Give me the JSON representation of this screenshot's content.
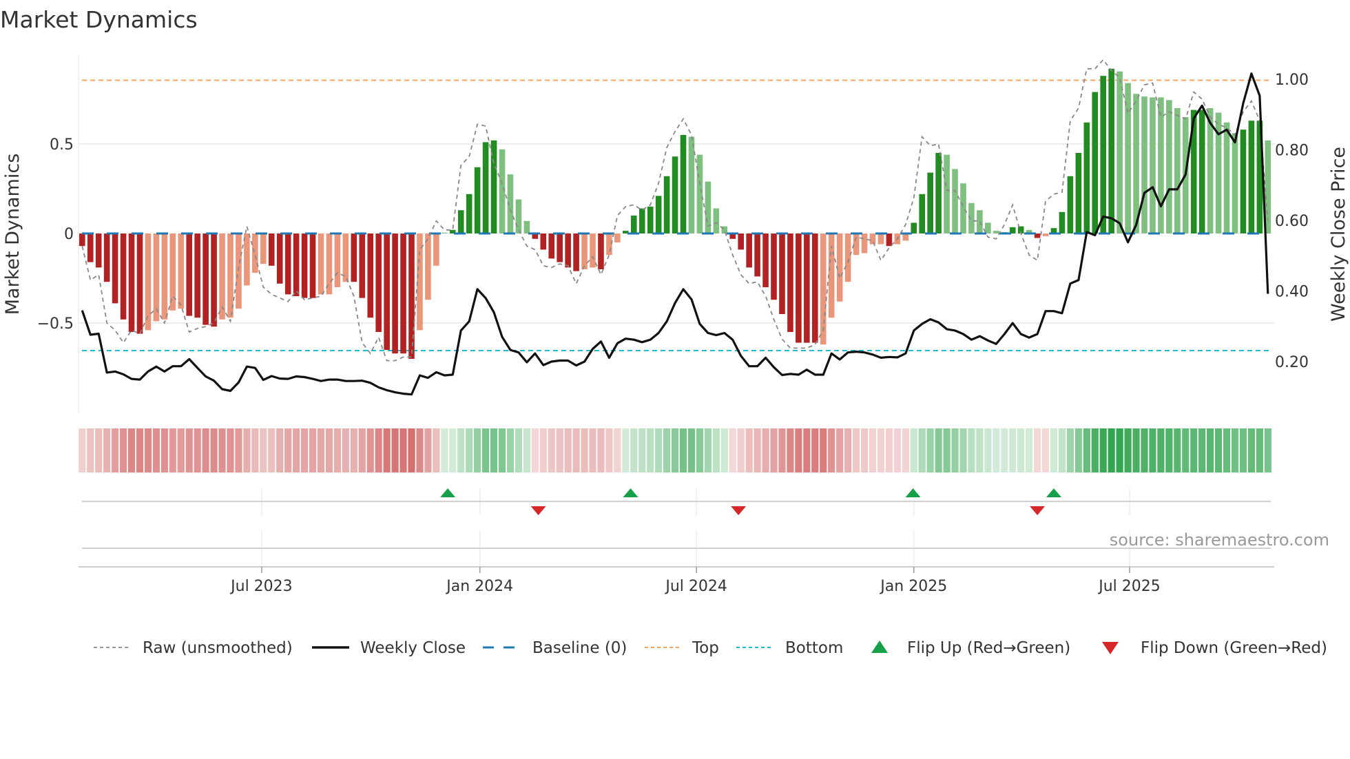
{
  "title": "Market Dynamics",
  "source": "source: sharemaestro.com",
  "colors": {
    "bar_neg_strong": "#b22222",
    "bar_neg_weak": "#e9967a",
    "bar_pos_strong": "#228b22",
    "bar_pos_weak": "#7fbf7f",
    "raw": "#888888",
    "close": "#111111",
    "baseline": "#1f77b4",
    "top": "#f4a460",
    "bottom": "#17becf",
    "flip_up": "#16a04a",
    "flip_down": "#d62728",
    "strip_red": "200,70,70",
    "strip_green": "40,160,70"
  },
  "chart_data": {
    "type": "bar",
    "title": "Market Dynamics",
    "ylabel": "Market Dynamics",
    "y2label": "Weekly Close Price",
    "ylim": [
      -1.0,
      0.99
    ],
    "y2lim": [
      0.0,
      1.225
    ],
    "yticks": [
      {
        "value": 0.5,
        "label": "0.5"
      },
      {
        "value": 0,
        "label": "0"
      },
      {
        "value": -0.5,
        "label": "−0.5"
      }
    ],
    "y2ticks": [
      {
        "value": 1.0,
        "label": "1.00"
      },
      {
        "value": 0.8,
        "label": "0.80"
      },
      {
        "value": 0.6,
        "label": "0.60"
      },
      {
        "value": 0.4,
        "label": "0.40"
      },
      {
        "value": 0.2,
        "label": "0.20"
      }
    ],
    "grid_y": [
      0.5,
      -0.5
    ],
    "x_unit": "week index (1 = first bar)",
    "xlim": [
      0.6,
      145.5
    ],
    "xticks": [
      {
        "week": 22.8,
        "label": "Jul 2023"
      },
      {
        "week": 49.3,
        "label": "Jan 2024"
      },
      {
        "week": 75.6,
        "label": "Jul 2024"
      },
      {
        "week": 102.0,
        "label": "Jan 2025"
      },
      {
        "week": 128.2,
        "label": "Jul 2025"
      }
    ],
    "top_level": 0.856,
    "bottom_level": -0.654,
    "baseline": 0,
    "values": [
      -0.07,
      -0.16,
      -0.19,
      -0.27,
      -0.39,
      -0.48,
      -0.55,
      -0.56,
      -0.54,
      -0.49,
      -0.48,
      -0.43,
      -0.42,
      -0.46,
      -0.47,
      -0.51,
      -0.52,
      -0.48,
      -0.47,
      -0.42,
      -0.29,
      -0.22,
      -0.17,
      -0.18,
      -0.28,
      -0.34,
      -0.35,
      -0.36,
      -0.36,
      -0.34,
      -0.34,
      -0.3,
      -0.27,
      -0.27,
      -0.36,
      -0.47,
      -0.55,
      -0.65,
      -0.67,
      -0.67,
      -0.7,
      -0.54,
      -0.37,
      -0.18,
      0.005,
      0.02,
      0.13,
      0.22,
      0.37,
      0.51,
      0.52,
      0.47,
      0.33,
      0.19,
      0.07,
      -0.03,
      -0.09,
      -0.14,
      -0.16,
      -0.19,
      -0.21,
      -0.2,
      -0.19,
      -0.2,
      -0.12,
      -0.05,
      0.015,
      0.1,
      0.14,
      0.15,
      0.21,
      0.32,
      0.43,
      0.55,
      0.54,
      0.44,
      0.29,
      0.14,
      0.04,
      -0.03,
      -0.09,
      -0.19,
      -0.24,
      -0.3,
      -0.37,
      -0.45,
      -0.55,
      -0.61,
      -0.61,
      -0.61,
      -0.62,
      -0.47,
      -0.38,
      -0.27,
      -0.12,
      -0.11,
      -0.06,
      -0.06,
      -0.07,
      -0.06,
      -0.04,
      0.06,
      0.22,
      0.34,
      0.45,
      0.44,
      0.36,
      0.28,
      0.17,
      0.13,
      0.06,
      0.015,
      0.008,
      0.035,
      0.04,
      0.02,
      -0.025,
      -0.015,
      0.03,
      0.12,
      0.32,
      0.45,
      0.62,
      0.79,
      0.88,
      0.92,
      0.905,
      0.84,
      0.78,
      0.765,
      0.76,
      0.76,
      0.745,
      0.7,
      0.65,
      0.69,
      0.69,
      0.7,
      0.675,
      0.62,
      0.56,
      0.58,
      0.63,
      0.63,
      0.52
    ],
    "momentum_shade": "DDDDDDDD LLLLL DDDD LLLLLL DDDDDD LLLL DDDDDDDD LLLL DDDDDD LLLL DDDDDD LL D LL DDDDDDDD LLLLL DDDDDDDDDDD LLLLLLLL D LL DDDD LLLLLLLL DD L D L DDDDDDDD LLLLLLLLL DD LLLL DDD L",
    "raw": [
      -0.07,
      -0.26,
      -0.23,
      -0.5,
      -0.54,
      -0.61,
      -0.54,
      -0.56,
      -0.46,
      -0.42,
      -0.5,
      -0.35,
      -0.4,
      -0.55,
      -0.53,
      -0.52,
      -0.5,
      -0.41,
      -0.49,
      -0.19,
      0.04,
      -0.12,
      -0.3,
      -0.34,
      -0.36,
      -0.38,
      -0.32,
      -0.37,
      -0.36,
      -0.35,
      -0.28,
      -0.22,
      -0.24,
      -0.35,
      -0.61,
      -0.67,
      -0.58,
      -0.71,
      -0.71,
      -0.69,
      -0.69,
      -0.09,
      -0.03,
      0.07,
      0.02,
      0.02,
      0.38,
      0.43,
      0.61,
      0.6,
      0.39,
      0.28,
      0.13,
      0.02,
      -0.07,
      -0.09,
      -0.18,
      -0.19,
      -0.17,
      -0.18,
      -0.28,
      -0.18,
      -0.13,
      -0.23,
      -0.12,
      0.1,
      0.15,
      0.16,
      0.13,
      0.16,
      0.28,
      0.48,
      0.57,
      0.64,
      0.55,
      0.28,
      0.04,
      0.06,
      0.02,
      -0.12,
      -0.23,
      -0.28,
      -0.27,
      -0.35,
      -0.48,
      -0.59,
      -0.64,
      -0.64,
      -0.64,
      -0.62,
      -0.54,
      -0.07,
      -0.25,
      -0.16,
      -0.02,
      -0.03,
      -0.04,
      -0.15,
      -0.08,
      -0.03,
      0.05,
      0.2,
      0.54,
      0.49,
      0.5,
      0.24,
      0.24,
      0.15,
      0.07,
      0.07,
      -0.02,
      -0.03,
      0.05,
      0.16,
      0.0,
      -0.12,
      -0.15,
      0.18,
      0.22,
      0.23,
      0.63,
      0.7,
      0.92,
      0.92,
      0.97,
      0.91,
      0.87,
      0.67,
      0.74,
      0.83,
      0.84,
      0.65,
      0.68,
      0.66,
      0.64,
      0.79,
      0.75,
      0.65,
      0.61,
      0.59,
      0.55,
      0.68,
      0.74,
      0.63,
      0.07
    ],
    "weekly_close": [
      0.345,
      0.276,
      0.279,
      0.169,
      0.172,
      0.164,
      0.151,
      0.149,
      0.172,
      0.186,
      0.172,
      0.187,
      0.187,
      0.207,
      0.182,
      0.158,
      0.146,
      0.122,
      0.117,
      0.141,
      0.186,
      0.182,
      0.148,
      0.159,
      0.152,
      0.151,
      0.158,
      0.156,
      0.151,
      0.145,
      0.149,
      0.149,
      0.145,
      0.145,
      0.146,
      0.14,
      0.127,
      0.119,
      0.113,
      0.109,
      0.107,
      0.161,
      0.154,
      0.17,
      0.161,
      0.163,
      0.288,
      0.314,
      0.405,
      0.38,
      0.34,
      0.27,
      0.233,
      0.226,
      0.198,
      0.223,
      0.19,
      0.2,
      0.203,
      0.203,
      0.189,
      0.2,
      0.236,
      0.257,
      0.211,
      0.252,
      0.265,
      0.262,
      0.255,
      0.262,
      0.281,
      0.314,
      0.366,
      0.405,
      0.376,
      0.307,
      0.281,
      0.275,
      0.281,
      0.262,
      0.216,
      0.187,
      0.187,
      0.211,
      0.184,
      0.162,
      0.165,
      0.163,
      0.177,
      0.163,
      0.163,
      0.223,
      0.206,
      0.226,
      0.228,
      0.226,
      0.22,
      0.211,
      0.213,
      0.212,
      0.223,
      0.288,
      0.307,
      0.32,
      0.311,
      0.292,
      0.288,
      0.278,
      0.262,
      0.272,
      0.26,
      0.25,
      0.278,
      0.309,
      0.278,
      0.268,
      0.278,
      0.343,
      0.343,
      0.337,
      0.421,
      0.431,
      0.567,
      0.558,
      0.611,
      0.606,
      0.592,
      0.538,
      0.587,
      0.678,
      0.694,
      0.64,
      0.688,
      0.688,
      0.73,
      0.889,
      0.925,
      0.876,
      0.844,
      0.857,
      0.821,
      0.932,
      1.016,
      0.953,
      0.392
    ],
    "flip_up_weeks": [
      45.4,
      67.6,
      101.9,
      119.0
    ],
    "flip_down_weeks": [
      56.4,
      80.7,
      117.0
    ],
    "legend_position": "bottom",
    "legend": [
      {
        "key": "raw",
        "label": "Raw (unsmoothed)"
      },
      {
        "key": "close",
        "label": "Weekly Close"
      },
      {
        "key": "baseline",
        "label": "Baseline (0)"
      },
      {
        "key": "top",
        "label": "Top"
      },
      {
        "key": "bottom",
        "label": "Bottom"
      },
      {
        "key": "flip_up",
        "label": "Flip Up (Red→Green)"
      },
      {
        "key": "flip_down",
        "label": "Flip Down (Green→Red)"
      }
    ]
  }
}
